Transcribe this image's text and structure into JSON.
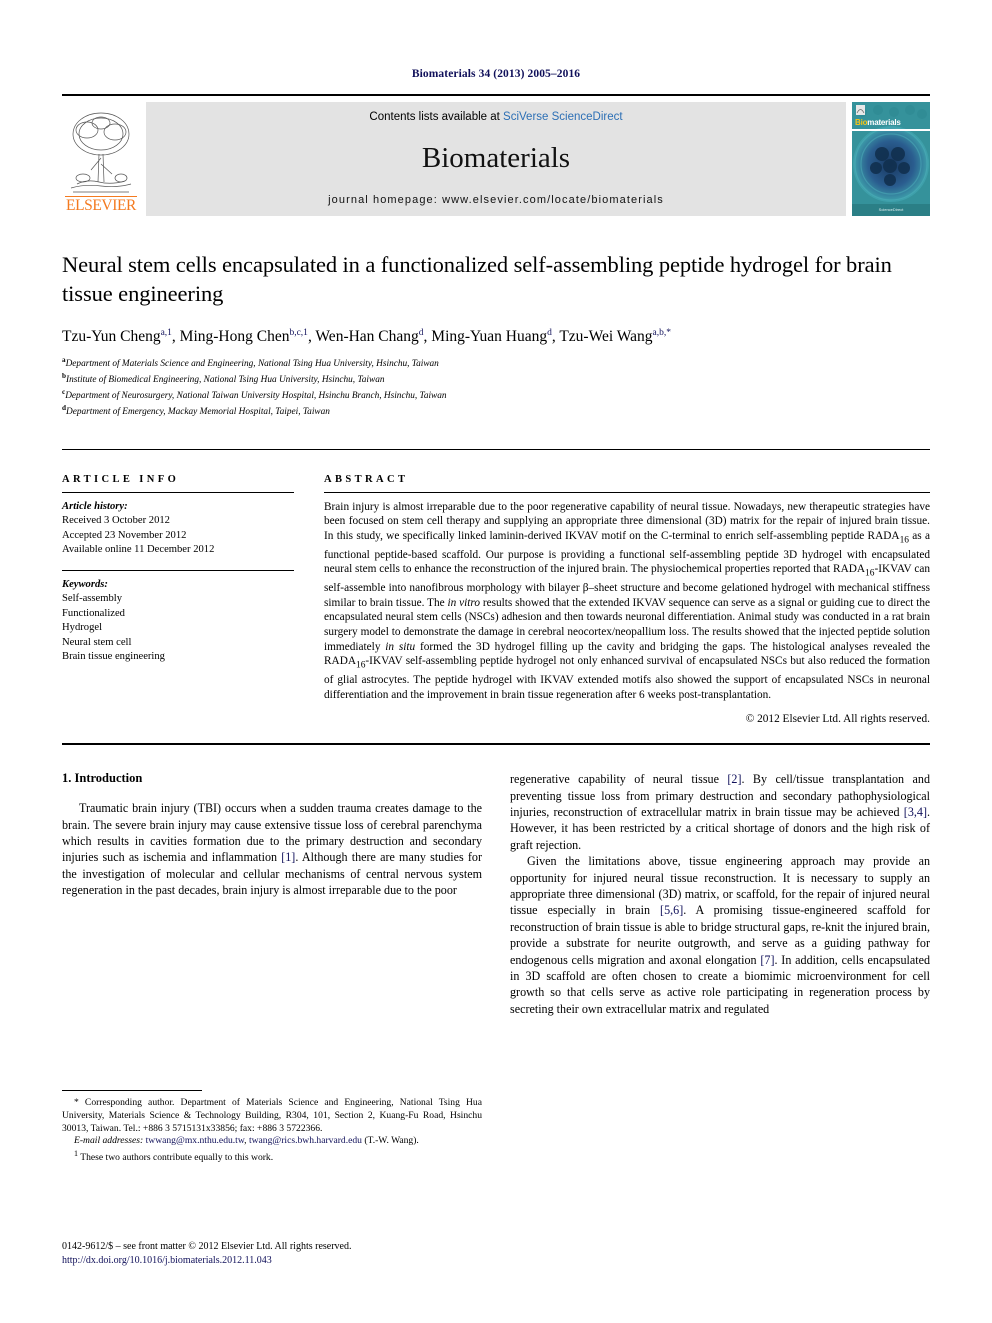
{
  "running_head": "Biomaterials 34 (2013) 2005–2016",
  "header": {
    "contents_prefix": "Contents lists available at ",
    "sciencedirect": "SciVerse ScienceDirect",
    "journal_name": "Biomaterials",
    "homepage": "journal homepage: www.elsevier.com/locate/biomaterials",
    "publisher": "ELSEVIER",
    "cover": {
      "title_part1": "Bio",
      "title_part2": "materials",
      "footer": "ScienceDirect"
    }
  },
  "title": "Neural stem cells encapsulated in a functionalized self-assembling peptide hydrogel for brain tissue engineering",
  "authors": [
    {
      "name": "Tzu-Yun Cheng",
      "sup": "a,1",
      "sep": ", "
    },
    {
      "name": "Ming-Hong Chen",
      "sup": "b,c,1",
      "sep": ", "
    },
    {
      "name": "Wen-Han Chang",
      "sup": "d",
      "sep": ", "
    },
    {
      "name": "Ming-Yuan Huang",
      "sup": "d",
      "sep": ", "
    },
    {
      "name": "Tzu-Wei Wang",
      "sup": "a,b,*",
      "sep": ""
    }
  ],
  "affiliations": [
    {
      "mark": "a",
      "text": "Department of Materials Science and Engineering, National Tsing Hua University, Hsinchu, Taiwan"
    },
    {
      "mark": "b",
      "text": "Institute of Biomedical Engineering, National Tsing Hua University, Hsinchu, Taiwan"
    },
    {
      "mark": "c",
      "text": "Department of Neurosurgery, National Taiwan University Hospital, Hsinchu Branch, Hsinchu, Taiwan"
    },
    {
      "mark": "d",
      "text": "Department of Emergency, Mackay Memorial Hospital, Taipei, Taiwan"
    }
  ],
  "article_info": {
    "heading": "ARTICLE INFO",
    "history_label": "Article history:",
    "history": [
      "Received 3 October 2012",
      "Accepted 23 November 2012",
      "Available online 11 December 2012"
    ],
    "keywords_label": "Keywords:",
    "keywords": [
      "Self-assembly",
      "Functionalized",
      "Hydrogel",
      "Neural stem cell",
      "Brain tissue engineering"
    ]
  },
  "abstract": {
    "heading": "ABSTRACT",
    "part1": "Brain injury is almost irreparable due to the poor regenerative capability of neural tissue. Nowadays, new therapeutic strategies have been focused on stem cell therapy and supplying an appropriate three dimensional (3D) matrix for the repair of injured brain tissue. In this study, we specifically linked laminin-derived IKVAV motif on the C-terminal to enrich self-assembling peptide RADA",
    "sub1": "16",
    "part2": " as a functional peptide-based scaffold. Our purpose is providing a functional self-assembling peptide 3D hydrogel with encapsulated neural stem cells to enhance the reconstruction of the injured brain. The physiochemical properties reported that RADA",
    "sub2": "16",
    "part3": "-IKVAV can self-assemble into nanofibrous morphology with bilayer β–sheet structure and become gelationed hydrogel with mechanical stiffness similar to brain tissue. The ",
    "ital1": "in vitro",
    "part4": " results showed that the extended IKVAV sequence can serve as a signal or guiding cue to direct the encapsulated neural stem cells (NSCs) adhesion and then towards neuronal differentiation. Animal study was conducted in a rat brain surgery model to demonstrate the damage in cerebral neocortex/neopallium loss. The results showed that the injected peptide solution immediately ",
    "ital2": "in situ",
    "part5": " formed the 3D hydrogel filling up the cavity and bridging the gaps. The histological analyses revealed the RADA",
    "sub3": "16",
    "part6": "-IKVAV self-assembling peptide hydrogel not only enhanced survival of encapsulated NSCs but also reduced the formation of glial astrocytes. The peptide hydrogel with IKVAV extended motifs also showed the support of encapsulated NSCs in neuronal differentiation and the improvement in brain tissue regeneration after 6 weeks post-transplantation.",
    "copyright": "© 2012 Elsevier Ltd. All rights reserved."
  },
  "body": {
    "section_heading": "1. Introduction",
    "left_paragraph_1a": "Traumatic brain injury (TBI) occurs when a sudden trauma creates damage to the brain. The severe brain injury may cause extensive tissue loss of cerebral parenchyma which results in cavities formation due to the primary destruction and secondary injuries such as ischemia and inflammation ",
    "ref_1": "[1]",
    "left_paragraph_1b": ". Although there are many studies for the investigation of molecular and cellular mechanisms of central nervous system regeneration in the past decades, brain injury is almost irreparable due to the poor",
    "right_paragraph_1a": "regenerative capability of neural tissue ",
    "ref_2": "[2]",
    "right_paragraph_1b": ". By cell/tissue transplantation and preventing tissue loss from primary destruction and secondary pathophysiological injuries, reconstruction of extracellular matrix in brain tissue may be achieved ",
    "ref_34": "[3,4]",
    "right_paragraph_1c": ". However, it has been restricted by a critical shortage of donors and the high risk of graft rejection.",
    "right_paragraph_2a": "Given the limitations above, tissue engineering approach may provide an opportunity for injured neural tissue reconstruction. It is necessary to supply an appropriate three dimensional (3D) matrix, or scaffold, for the repair of injured neural tissue especially in brain ",
    "ref_56": "[5,6]",
    "right_paragraph_2b": ". A promising tissue-engineered scaffold for reconstruction of brain tissue is able to bridge structural gaps, re-knit the injured brain, provide a substrate for neurite outgrowth, and serve as a guiding pathway for endogenous cells migration and axonal elongation ",
    "ref_7": "[7]",
    "right_paragraph_2c": ". In addition, cells encapsulated in 3D scaffold are often chosen to create a biomimic microenvironment for cell growth so that cells serve as active role participating in regeneration process by secreting their own extracellular matrix and regulated"
  },
  "footnotes": {
    "corresponding_mark": "*",
    "corresponding": " Corresponding author. Department of Materials Science and Engineering, National Tsing Hua University, Materials Science & Technology Building, R304, 101, Section 2, Kuang-Fu Road, Hsinchu 30013, Taiwan. Tel.: +886 3 5715131x33856; fax: +886 3 5722366.",
    "email_label": "E-mail addresses:",
    "email_1": "twwang@mx.nthu.edu.tw",
    "email_sep": ", ",
    "email_2": "twang@rics.bwh.harvard.edu",
    "email_owner": " (T.-W. Wang).",
    "equal_mark": "1",
    "equal_contrib": " These two authors contribute equally to this work."
  },
  "bottom": {
    "issn": "0142-9612/$ – see front matter © 2012 Elsevier Ltd. All rights reserved.",
    "doi": "http://dx.doi.org/10.1016/j.biomaterials.2012.11.043"
  }
}
